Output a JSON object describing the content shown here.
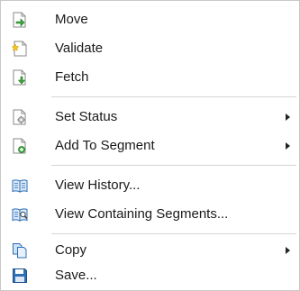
{
  "menu": {
    "items": [
      {
        "label": "Move",
        "icon": "move-icon",
        "submenu": false
      },
      {
        "label": "Validate",
        "icon": "validate-icon",
        "submenu": false
      },
      {
        "label": "Fetch",
        "icon": "fetch-icon",
        "submenu": false
      },
      {
        "label": "Set Status",
        "icon": "set-status-icon",
        "submenu": true
      },
      {
        "label": "Add To Segment",
        "icon": "add-to-segment-icon",
        "submenu": true
      },
      {
        "label": "View History...",
        "icon": "book-icon",
        "submenu": false
      },
      {
        "label": "View Containing Segments...",
        "icon": "book-search-icon",
        "submenu": false
      },
      {
        "label": "Copy",
        "icon": "copy-icon",
        "submenu": true
      },
      {
        "label": "Save...",
        "icon": "save-icon",
        "submenu": false
      }
    ]
  },
  "colors": {
    "border": "#c8c8c8",
    "separator": "#d4d4d4",
    "text": "#1a1a1a",
    "accent_green": "#3da73d",
    "accent_blue": "#2f6fb5"
  }
}
